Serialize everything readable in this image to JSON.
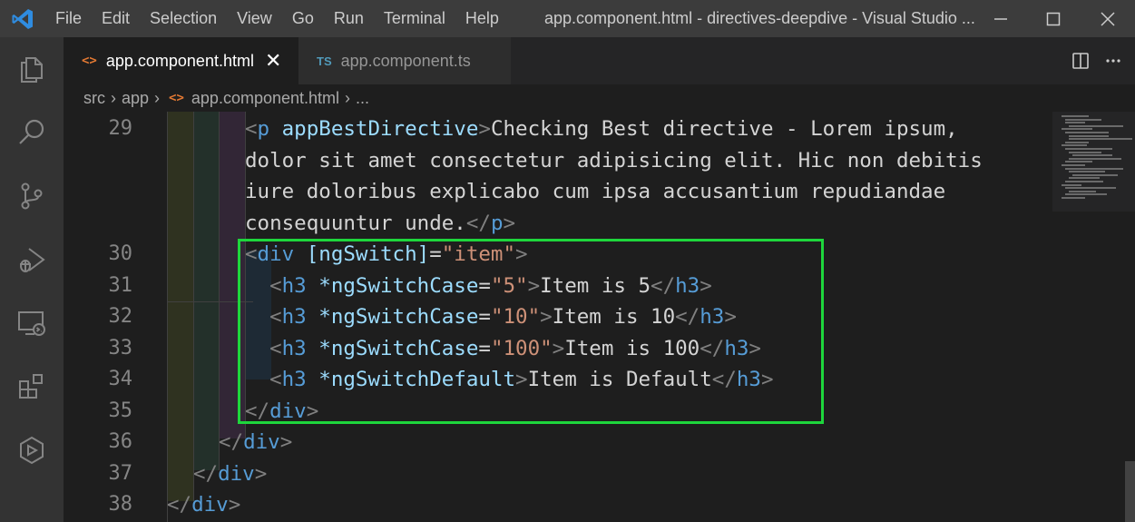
{
  "titlebar": {
    "menu": [
      "File",
      "Edit",
      "Selection",
      "View",
      "Go",
      "Run",
      "Terminal",
      "Help"
    ],
    "window_title": "app.component.html - directives-deepdive - Visual Studio ...",
    "icons": [
      "vscode-logo-icon",
      "minimize-icon",
      "maximize-icon",
      "close-icon"
    ]
  },
  "activitybar": {
    "icons": [
      "explorer-icon",
      "search-icon",
      "source-control-icon",
      "run-debug-icon",
      "remote-explorer-icon",
      "extensions-icon",
      "live-share-icon"
    ]
  },
  "tabs": [
    {
      "icon": "<>",
      "label": "app.component.html",
      "active": true
    },
    {
      "icon": "TS",
      "label": "app.component.ts",
      "active": false
    }
  ],
  "editor_actions": [
    "split-editor-icon",
    "more-actions-icon"
  ],
  "breadcrumb": {
    "items": [
      "src",
      "app",
      "app.component.html",
      "..."
    ],
    "separator": "›",
    "file_icon": "<>"
  },
  "code": {
    "line_numbers": [
      "29",
      "",
      "",
      "",
      "30",
      "31",
      "32",
      "33",
      "34",
      "35",
      "36",
      "37",
      "38"
    ],
    "lines": [
      [
        [
          "tg",
          "<"
        ],
        [
          "tn",
          "p"
        ],
        [
          "tx",
          " "
        ],
        [
          "an",
          "appBestDirective"
        ],
        [
          "tg",
          ">"
        ],
        [
          "tx",
          "Checking Best directive - Lorem ipsum,"
        ]
      ],
      [
        [
          "tx",
          "dolor sit amet consectetur adipisicing elit. Hic non debitis"
        ]
      ],
      [
        [
          "tx",
          "iure doloribus explicabo cum ipsa accusantium repudiandae"
        ]
      ],
      [
        [
          "tx",
          "consequuntur unde."
        ],
        [
          "tg",
          "</"
        ],
        [
          "tn",
          "p"
        ],
        [
          "tg",
          ">"
        ]
      ],
      [
        [
          "tg",
          "<"
        ],
        [
          "tn",
          "div"
        ],
        [
          "tx",
          " "
        ],
        [
          "an",
          "[ngSwitch]"
        ],
        [
          "tx",
          "="
        ],
        [
          "av",
          "\"item\""
        ],
        [
          "tg",
          ">"
        ]
      ],
      [
        [
          "tx",
          "  "
        ],
        [
          "tg",
          "<"
        ],
        [
          "tn",
          "h3"
        ],
        [
          "tx",
          " "
        ],
        [
          "an",
          "*ngSwitchCase"
        ],
        [
          "tx",
          "="
        ],
        [
          "av",
          "\"5\""
        ],
        [
          "tg",
          ">"
        ],
        [
          "tx",
          "Item is 5"
        ],
        [
          "tg",
          "</"
        ],
        [
          "tn",
          "h3"
        ],
        [
          "tg",
          ">"
        ]
      ],
      [
        [
          "tx",
          "  "
        ],
        [
          "tg",
          "<"
        ],
        [
          "tn",
          "h3"
        ],
        [
          "tx",
          " "
        ],
        [
          "an",
          "*ngSwitchCase"
        ],
        [
          "tx",
          "="
        ],
        [
          "av",
          "\"10\""
        ],
        [
          "tg",
          ">"
        ],
        [
          "tx",
          "Item is 10"
        ],
        [
          "tg",
          "</"
        ],
        [
          "tn",
          "h3"
        ],
        [
          "tg",
          ">"
        ]
      ],
      [
        [
          "tx",
          "  "
        ],
        [
          "tg",
          "<"
        ],
        [
          "tn",
          "h3"
        ],
        [
          "tx",
          " "
        ],
        [
          "an",
          "*ngSwitchCase"
        ],
        [
          "tx",
          "="
        ],
        [
          "av",
          "\"100\""
        ],
        [
          "tg",
          ">"
        ],
        [
          "tx",
          "Item is 100"
        ],
        [
          "tg",
          "</"
        ],
        [
          "tn",
          "h3"
        ],
        [
          "tg",
          ">"
        ]
      ],
      [
        [
          "tx",
          "  "
        ],
        [
          "tg",
          "<"
        ],
        [
          "tn",
          "h3"
        ],
        [
          "tx",
          " "
        ],
        [
          "an",
          "*ngSwitchDefault"
        ],
        [
          "tg",
          ">"
        ],
        [
          "tx",
          "Item is Default"
        ],
        [
          "tg",
          "</"
        ],
        [
          "tn",
          "h3"
        ],
        [
          "tg",
          ">"
        ]
      ],
      [
        [
          "tg",
          "</"
        ],
        [
          "tn",
          "div"
        ],
        [
          "tg",
          ">"
        ]
      ],
      [
        [
          "tg",
          "</"
        ],
        [
          "tn",
          "div"
        ],
        [
          "tg",
          ">"
        ]
      ],
      [
        [
          "tg",
          "</"
        ],
        [
          "tn",
          "div"
        ],
        [
          "tg",
          ">"
        ]
      ],
      [
        [
          "tg",
          "</"
        ],
        [
          "tn",
          "div"
        ],
        [
          "tg",
          ">"
        ]
      ]
    ],
    "colors": {
      "highlight_box": "#1ed63c",
      "tag": "#569cd6",
      "attribute": "#9cdcfe",
      "string": "#ce9178",
      "punctuation": "#808080",
      "text": "#d4d4d4"
    }
  }
}
